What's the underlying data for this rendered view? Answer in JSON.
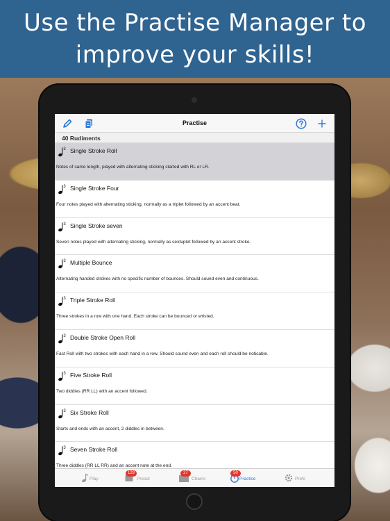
{
  "banner": {
    "title": "Use the Practise Manager to\nimprove your skills!"
  },
  "navbar": {
    "title": "Practise",
    "left_icons": [
      "pencil-icon",
      "document-icon"
    ],
    "right_icons": [
      "help-icon",
      "plus-icon"
    ]
  },
  "section": {
    "label": "40 Rudiments"
  },
  "rudiments": [
    {
      "title": "Single Stroke Roll",
      "description": "Notes of same length, played with alternating sticking started with RL or LR.",
      "selected": true
    },
    {
      "title": "Single Stroke Four",
      "description": "Four notes played with alternating sticking, normally as a triplet followed by an accent beat.",
      "selected": false
    },
    {
      "title": "Single Stroke seven",
      "description": "Seven notes played with alternating sticking, normally as sextuplet followed by an accent stroke.",
      "selected": false
    },
    {
      "title": "Multiple Bounce",
      "description": "Alternating handed strokes with no specific number of bounces. Should sound even and continuous.",
      "selected": false
    },
    {
      "title": "Triple Stroke Roll",
      "description": "Three strokes in a row with one hand. Each stroke can be bounced or wristed.",
      "selected": false
    },
    {
      "title": "Double Stroke Open Roll",
      "description": "Fast Roll with two strokes with each hand in a row. Should sound even and each roll should be noticable.",
      "selected": false
    },
    {
      "title": "Five Stroke Roll",
      "description": "Two diddles (RR LL) with an accent followed.",
      "selected": false
    },
    {
      "title": "Six Stroke Roll",
      "description": "Starts and ends with an accent, 2 diddles in between.",
      "selected": false
    },
    {
      "title": "Seven Stroke Roll",
      "description": "Three diddles (RR LL RR) and an accent note at the end.",
      "selected": false
    }
  ],
  "tabbar": {
    "tabs": [
      {
        "label": "Play",
        "icon": "note-icon",
        "badge": "",
        "active": false
      },
      {
        "label": "Preset",
        "icon": "preset-icon",
        "badge": "129",
        "active": false
      },
      {
        "label": "Chains",
        "icon": "folder-icon",
        "badge": "27",
        "active": false
      },
      {
        "label": "Practise",
        "icon": "timer-icon",
        "badge": "50",
        "active": true
      },
      {
        "label": "Prefs",
        "icon": "gear-icon",
        "badge": "",
        "active": false
      }
    ]
  },
  "colors": {
    "banner": "#2f6390",
    "accent": "#2f7bd8",
    "selected_row": "#d3d3d7",
    "badge": "#e2352d"
  }
}
